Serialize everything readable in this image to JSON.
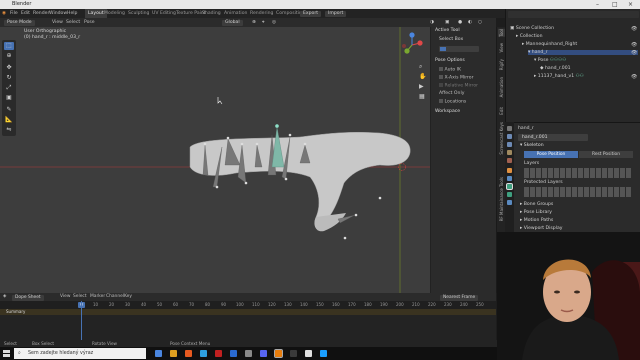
{
  "window": {
    "title": "Blender"
  },
  "menubar": {
    "items": [
      "File",
      "Edit",
      "Render",
      "Window",
      "Help"
    ],
    "workspaces": [
      "Layout",
      "Modeling",
      "Sculpting",
      "UV Editing",
      "Texture Paint",
      "Shading",
      "Animation",
      "Rendering",
      "Compositing",
      "Geometry Nodes",
      "Scripting"
    ],
    "active_workspace": "Layout",
    "export": "Export",
    "import": "Import",
    "scene": "Scene",
    "view_layer": "View Layer"
  },
  "viewport_header": {
    "mode": "Pose Mode",
    "menus": [
      "View",
      "Select",
      "Pose"
    ],
    "transform": "Global"
  },
  "viewport": {
    "info_line1": "User Orthographic",
    "info_line2": "(0) hand_r : middle_03_r"
  },
  "npanel": {
    "active_tool_title": "Active Tool",
    "tool_name": "Select Box",
    "pose_options_title": "Pose Options",
    "auto_ik": "Auto IK",
    "x_axis_mirror": "X-Axis Mirror",
    "relative_mirror": "Relative Mirror",
    "affect_only": "Affect Only",
    "locations": "Locations",
    "workspace_title": "Workspace",
    "tabs": [
      "Tool",
      "View",
      "Rigify",
      "Animation",
      "Edit",
      "Screencast Keys",
      "RF Maintainance Tools"
    ]
  },
  "outliner": {
    "rows": [
      "Scene Collection",
      "Collection",
      "Mannequinhand_Right",
      "hand_r",
      "Pose",
      "hand_r.001",
      "11137_hand_v1"
    ]
  },
  "properties": {
    "object_name": "hand_r",
    "data_name": "hand_r.001",
    "skeleton": "Skeleton",
    "pose_position": "Pose Position",
    "rest_position": "Rest Position",
    "layers": "Layers",
    "protected_layers": "Protected Layers",
    "sections": [
      "Bone Groups",
      "Pose Library",
      "Motion Paths",
      "Viewport Display",
      "Inverse Kinematics",
      "Rigify Bone Groups",
      "Rigify Layer Names",
      "Rigify Generation",
      "Custom Properties"
    ]
  },
  "timeline": {
    "mode": "Dope Sheet",
    "menus": [
      "View",
      "Select",
      "Marker",
      "Channel",
      "Key"
    ],
    "filter": "Nearest Frame",
    "summary": "Summary",
    "current_frame": "0",
    "ticks": [
      "0",
      "10",
      "20",
      "30",
      "40",
      "50",
      "60",
      "70",
      "80",
      "90",
      "100",
      "110",
      "120",
      "130",
      "140",
      "150",
      "160",
      "170",
      "180",
      "190",
      "200",
      "210",
      "220",
      "230",
      "240",
      "250"
    ]
  },
  "statusbar": {
    "select": "Select",
    "box_select": "Box Select",
    "rotate_view": "Rotate View",
    "pose_context_menu": "Pose Context Menu"
  },
  "taskbar": {
    "search_placeholder": "Sem zadejte hledaný výraz"
  }
}
